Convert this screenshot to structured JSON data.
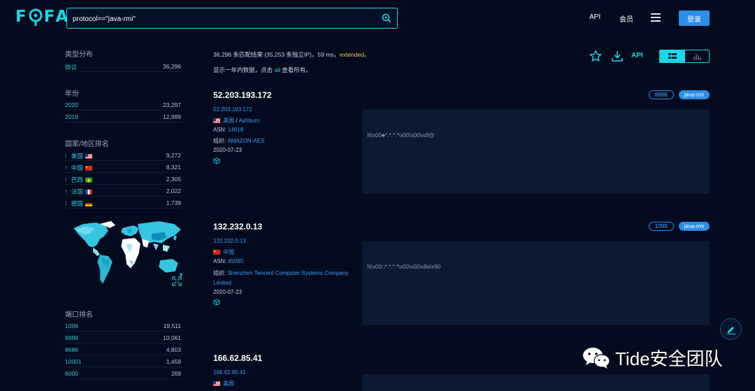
{
  "header": {
    "search_value": "protocol==\"java-rmi\"",
    "nav_api": "API",
    "nav_member": "会员",
    "login": "登录",
    "logo_letters": [
      "F",
      "F",
      "A"
    ]
  },
  "sidebar": {
    "type_dist": {
      "title": "类型分布",
      "rows": [
        {
          "label": "协议",
          "count": "36,296"
        }
      ]
    },
    "year": {
      "title": "年份",
      "rows": [
        {
          "label": "2020",
          "count": "23,297"
        },
        {
          "label": "2019",
          "count": "12,999"
        }
      ]
    },
    "country": {
      "title": "国家/地区排名",
      "rows": [
        {
          "label": "美国",
          "flag": "us",
          "count": "9,272"
        },
        {
          "label": "中国",
          "flag": "cn",
          "count": "8,321"
        },
        {
          "label": "巴西",
          "flag": "br",
          "count": "2,305"
        },
        {
          "label": "法国",
          "flag": "fr",
          "count": "2,022"
        },
        {
          "label": "德国",
          "flag": "de",
          "count": "1,739"
        }
      ]
    },
    "port": {
      "title": "端口排名",
      "rows": [
        {
          "label": "1099",
          "count": "19,511"
        },
        {
          "label": "9999",
          "count": "10,061"
        },
        {
          "label": "8686",
          "count": "4,803"
        },
        {
          "label": "10001",
          "count": "1,459"
        },
        {
          "label": "6000",
          "count": "269"
        }
      ]
    }
  },
  "summary": {
    "text": "36,296 条匹配结果 (35,253 条独立IP)，59 ms，",
    "extended": "extended",
    "end": "。",
    "recent_pre": "显示一年内数据，点击 ",
    "recent_all": "all",
    "recent_post": " 查看所有。"
  },
  "tools": {
    "api": "API"
  },
  "results": [
    {
      "ip": "52.203.193.172",
      "port": "8686",
      "protocol": "java-rmi",
      "link": "52.203.193.172",
      "country": "美国",
      "flag": "us",
      "sep": " / ",
      "city": "Ashburn",
      "asn_label": "ASN: ",
      "asn": "14618",
      "org_label": "组织: ",
      "org": "AMAZON-AES",
      "date": "2020-07-23",
      "banner": "N\\x00♣*.*.*.*\\x00\\x00\\xdf@"
    },
    {
      "ip": "132.232.0.13",
      "port": "1099",
      "protocol": "java-rmi",
      "link": "132.232.0.13",
      "country": "中国",
      "flag": "cn",
      "asn_label": "ASN: ",
      "asn": "45090",
      "org_label": "组织: ",
      "org": "Shenzhen Tencent Computer Systems Company Limited",
      "date": "2020-07-23",
      "banner": "N\\x00□*.*.*.*\\x00\\x00\\x8a\\x90"
    },
    {
      "ip": "166.62.85.41",
      "link": "166.62.85.41",
      "country": "美国",
      "flag": "us"
    }
  ],
  "watermark": "Tide安全团队",
  "colors": {
    "accent": "#1bd6e6",
    "link": "#3a9cf0",
    "primary": "#2b8ee8",
    "bg": "#050b1e",
    "extended": "#f2c94c"
  }
}
